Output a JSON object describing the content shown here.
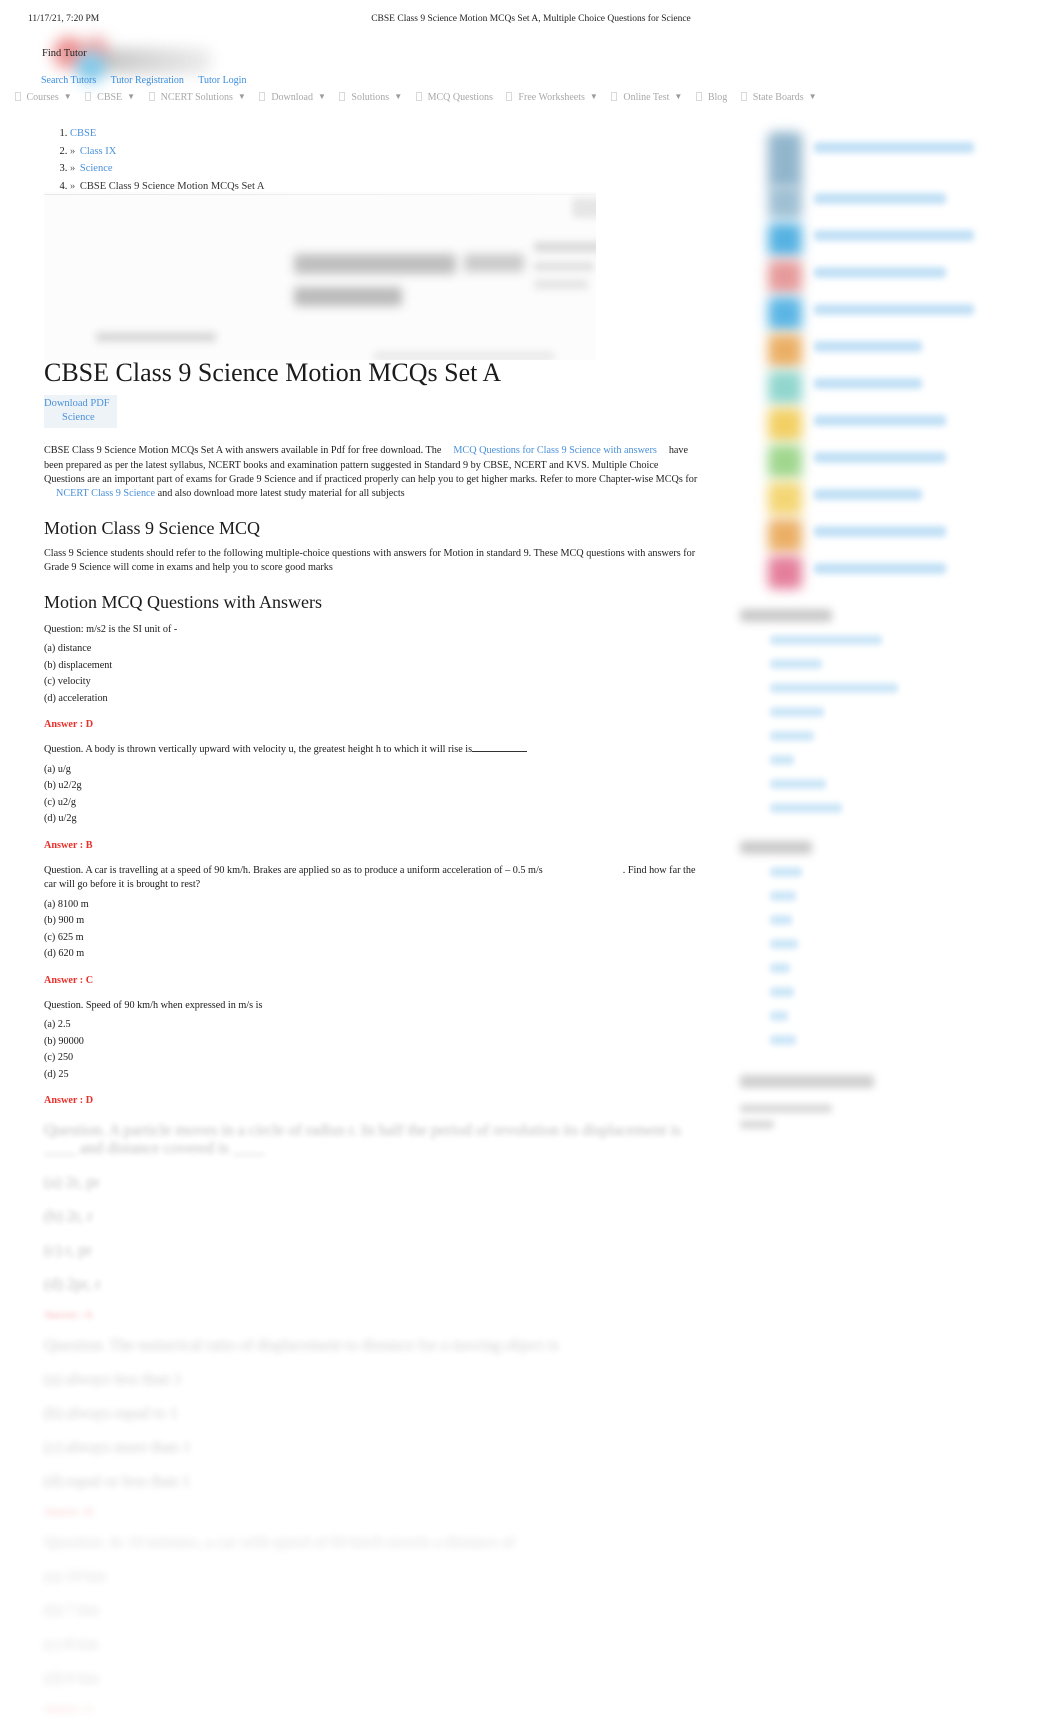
{
  "print_header": {
    "date": "11/17/21, 7:20 PM",
    "title": "CBSE Class 9 Science Motion MCQs Set A, Multiple Choice Questions for Science"
  },
  "header": {
    "find_tutor": "Find Tutor",
    "tutor_links": [
      {
        "label": "Search Tutors"
      },
      {
        "label": "Tutor Registration"
      },
      {
        "label": "Tutor Login"
      }
    ]
  },
  "nav": {
    "items": [
      {
        "label": "Courses",
        "caret": true
      },
      {
        "label": "CBSE",
        "caret": true
      },
      {
        "label": "NCERT Solutions",
        "caret": true
      },
      {
        "label": "Download",
        "caret": true
      },
      {
        "label": "Solutions",
        "caret": true
      },
      {
        "label": "MCQ Questions",
        "caret": false
      },
      {
        "label": "Free Worksheets",
        "caret": true
      },
      {
        "label": "Online Test",
        "caret": true
      },
      {
        "label": "Blog",
        "caret": false
      },
      {
        "label": "State Boards",
        "caret": true
      }
    ],
    "caret_glyph": "▼"
  },
  "breadcrumb": {
    "separator": "»",
    "items": [
      {
        "label": "CBSE",
        "link": true,
        "sep": false
      },
      {
        "label": "Class IX",
        "link": true,
        "sep": true
      },
      {
        "label": "Science",
        "link": true,
        "sep": true
      },
      {
        "label": "CBSE Class 9 Science Motion MCQs Set A",
        "link": false,
        "sep": true
      }
    ]
  },
  "article": {
    "title": "CBSE Class 9 Science Motion MCQs Set A",
    "pdf_box": {
      "line1": "Download PDF",
      "line2": "Science"
    },
    "intro": {
      "part1": "CBSE Class 9 Science Motion MCQs Set A with answers available in Pdf for free download. The",
      "link1": "MCQ Questions for Class 9 Science with answers",
      "part2": "have been prepared as per the latest syllabus, NCERT books and examination pattern suggested in Standard 9 by CBSE, NCERT and KVS. Multiple Choice Questions are an important part of exams for Grade 9 Science and if practiced properly can help you to get higher marks. Refer to more Chapter-wise MCQs for",
      "link2": "NCERT Class 9 Science",
      "part3": "and also download more latest study material for all subjects"
    },
    "section1_heading": "Motion Class 9 Science MCQ",
    "section1_text": "Class 9 Science students should refer to the following multiple-choice questions with answers for Motion in standard 9. These MCQ questions with answers for Grade 9 Science will come in exams and help you to score good marks",
    "section2_heading": "Motion MCQ Questions with Answers",
    "questions": [
      {
        "question": "Question: m/s2 is the SI unit of -",
        "options": [
          "(a) distance",
          "(b) displacement",
          "(c) velocity",
          "(d) acceleration"
        ],
        "answer": "Answer : D"
      },
      {
        "question_pre": "Question. A body is thrown vertically upward with velocity u, the greatest height h to which it will rise is",
        "question_post": "",
        "has_blank": true,
        "options": [
          "(a) u/g",
          "(b) u2/2g",
          "(c) u2/g",
          "(d) u/2g"
        ],
        "answer": "Answer : B"
      },
      {
        "question_pre": "Question. A car is travelling at a speed of 90 km/h. Brakes are applied so as to produce a uniform acceleration of – 0.5 m/s",
        "question_post": ". Find how far the car will go before it is brought to rest?",
        "has_blank": false,
        "options": [
          "(a) 8100 m",
          "(b) 900 m",
          "(c) 625 m",
          "(d) 620 m"
        ],
        "answer": "Answer : C"
      },
      {
        "question": "Question. Speed of 90 km/h when expressed in m/s is",
        "options": [
          "(a) 2.5",
          "(b) 90000",
          "(c) 250",
          "(d) 25"
        ],
        "answer": "Answer : D"
      }
    ],
    "faded_questions": [
      {
        "question": "Question. A particle moves in a circle of radius r. In half the period of revolution its displacement is ____ and distance covered is ____",
        "options": [
          "(a) 2r, pr",
          "(b) 2r, r",
          "(c) r, pr",
          "(d) 2pr, r"
        ],
        "answer": "Answer : A"
      },
      {
        "question": "Question. The numerical ratio of displacement to distance for a moving object is",
        "options": [
          "(a) always less than 1",
          "(b) always equal to 1",
          "(c) always more than 1",
          "(d) equal or less than 1"
        ],
        "answer": "Answer : D"
      },
      {
        "question": "Question. In 10 minutes, a car with speed of 60 km/h travels a distance of",
        "options": [
          "(a) 10 km",
          "(b) 7 km",
          "(c) 8 km",
          "(d) 6 km"
        ],
        "answer": "Answer : A"
      }
    ]
  },
  "sidebar": {
    "thumb_colors": [
      "#7fa9c4",
      "#8fb5cc",
      "#39a5dd",
      "#e28a8a",
      "#3fa9e0",
      "#e8a24c",
      "#7ecfc6",
      "#f0c84a",
      "#8fd07a",
      "#f2cf5c",
      "#e0698a"
    ],
    "section_count": 11
  },
  "colors": {
    "link_blue": "#4a90d9",
    "answer_red": "#e8302a",
    "nav_grey": "#a8a8a8",
    "pdf_box_bg": "#eef3f8"
  }
}
